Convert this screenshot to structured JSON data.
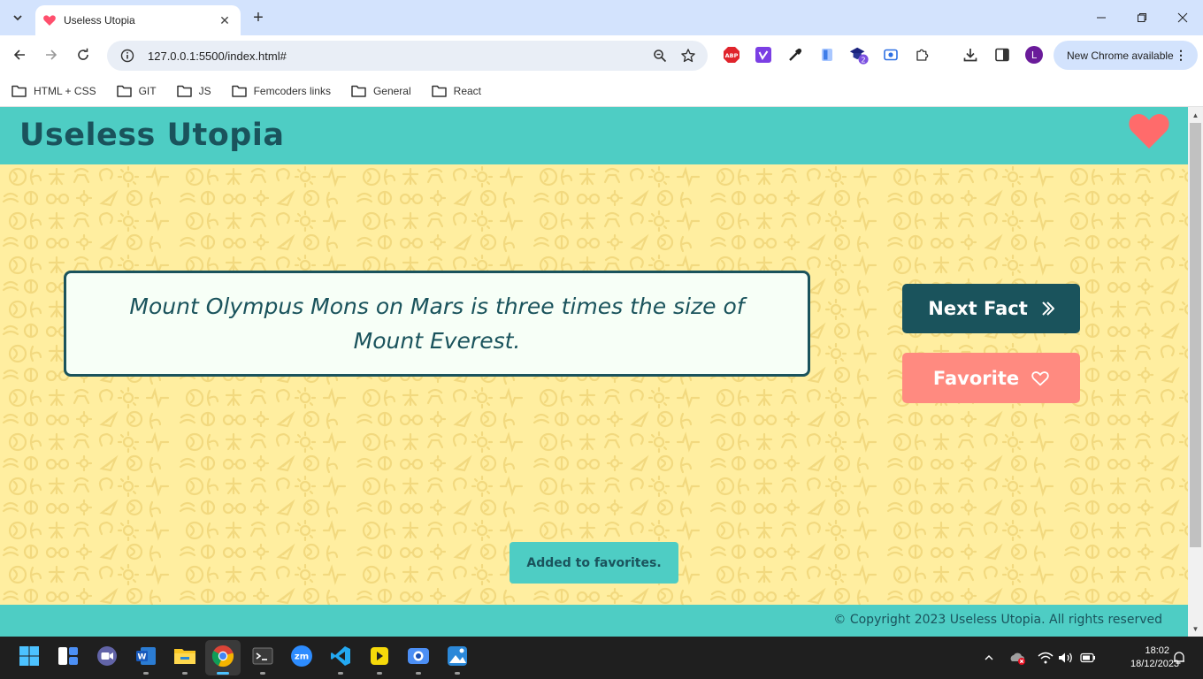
{
  "browser": {
    "tab_title": "Useless Utopia",
    "url": "127.0.0.1:5500/index.html#",
    "new_chrome_label": "New Chrome available",
    "profile_initial": "L",
    "extension_badge": "2",
    "abp_label": "ABP",
    "bookmarks": [
      "HTML + CSS",
      "GIT",
      "JS",
      "Femcoders links",
      "General",
      "React"
    ]
  },
  "site": {
    "title": "Useless Utopia",
    "fact": "Mount Olympus Mons on Mars is three times the size of Mount Everest.",
    "next_button": "Next Fact",
    "favorite_button": "Favorite",
    "toast": "Added to favorites.",
    "footer": "© Copyright 2023 Useless Utopia. All rights reserved",
    "colors": {
      "header": "#4ecdc4",
      "dark": "#1a535c",
      "background": "#ffeea0",
      "accent": "#ff6b6b",
      "favorite_button": "#ff8a80",
      "card": "#f7fff7"
    }
  },
  "taskbar": {
    "time": "18:02",
    "date": "18/12/2023",
    "zoom_label": "zm",
    "word_label": "W",
    "apps": [
      "windows-start-icon",
      "widgets-icon",
      "teams-icon",
      "word-icon",
      "file-explorer-icon",
      "chrome-icon",
      "terminal-icon",
      "zoom-icon",
      "vscode-icon",
      "sticky-app-icon",
      "camera-app-icon",
      "photos-icon"
    ]
  }
}
